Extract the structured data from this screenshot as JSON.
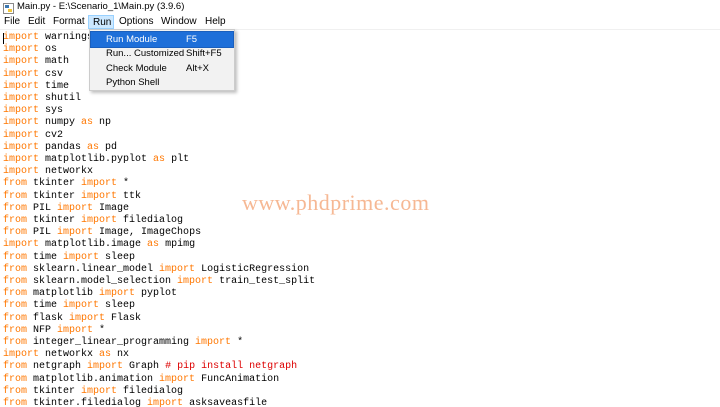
{
  "window": {
    "title": "Main.py - E:\\Scenario_1\\Main.py (3.9.6)"
  },
  "menubar": {
    "items": [
      "File",
      "Edit",
      "Format",
      "Run",
      "Options",
      "Window",
      "Help"
    ],
    "active": "Run"
  },
  "run_menu": {
    "items": [
      {
        "label": "Run Module",
        "accel": "F5",
        "highlighted": true
      },
      {
        "label": "Run... Customized",
        "accel": "Shift+F5"
      },
      {
        "label": "Check Module",
        "accel": "Alt+X"
      },
      {
        "label": "Python Shell",
        "accel": ""
      }
    ]
  },
  "editor": {
    "lines": [
      [
        [
          "kw",
          "import"
        ],
        [
          "t",
          " warnings"
        ]
      ],
      [
        [
          "kw",
          "import"
        ],
        [
          "t",
          " os"
        ]
      ],
      [
        [
          "kw",
          "import"
        ],
        [
          "t",
          " math"
        ]
      ],
      [
        [
          "kw",
          "import"
        ],
        [
          "t",
          " csv"
        ]
      ],
      [
        [
          "kw",
          "import"
        ],
        [
          "t",
          " time"
        ]
      ],
      [
        [
          "kw",
          "import"
        ],
        [
          "t",
          " shutil"
        ]
      ],
      [
        [
          "kw",
          "import"
        ],
        [
          "t",
          " sys"
        ]
      ],
      [
        [
          "kw",
          "import"
        ],
        [
          "t",
          " numpy "
        ],
        [
          "kw",
          "as"
        ],
        [
          "t",
          " np"
        ]
      ],
      [
        [
          "kw",
          "import"
        ],
        [
          "t",
          " cv2"
        ]
      ],
      [
        [
          "kw",
          "import"
        ],
        [
          "t",
          " pandas "
        ],
        [
          "kw",
          "as"
        ],
        [
          "t",
          " pd"
        ]
      ],
      [
        [
          "kw",
          "import"
        ],
        [
          "t",
          " matplotlib.pyplot "
        ],
        [
          "kw",
          "as"
        ],
        [
          "t",
          " plt"
        ]
      ],
      [
        [
          "kw",
          "import"
        ],
        [
          "t",
          " networkx"
        ]
      ],
      [
        [
          "kw",
          "from"
        ],
        [
          "t",
          " tkinter "
        ],
        [
          "kw",
          "import"
        ],
        [
          "t",
          " *"
        ]
      ],
      [
        [
          "kw",
          "from"
        ],
        [
          "t",
          " tkinter "
        ],
        [
          "kw",
          "import"
        ],
        [
          "t",
          " ttk"
        ]
      ],
      [
        [
          "kw",
          "from"
        ],
        [
          "t",
          " PIL "
        ],
        [
          "kw",
          "import"
        ],
        [
          "t",
          " Image"
        ]
      ],
      [
        [
          "kw",
          "from"
        ],
        [
          "t",
          " tkinter "
        ],
        [
          "kw",
          "import"
        ],
        [
          "t",
          " filedialog"
        ]
      ],
      [
        [
          "kw",
          "from"
        ],
        [
          "t",
          " PIL "
        ],
        [
          "kw",
          "import"
        ],
        [
          "t",
          " Image, ImageChops"
        ]
      ],
      [
        [
          "kw",
          "import"
        ],
        [
          "t",
          " matplotlib.image "
        ],
        [
          "kw",
          "as"
        ],
        [
          "t",
          " mpimg"
        ]
      ],
      [
        [
          "kw",
          "from"
        ],
        [
          "t",
          " time "
        ],
        [
          "kw",
          "import"
        ],
        [
          "t",
          " sleep"
        ]
      ],
      [
        [
          "kw",
          "from"
        ],
        [
          "t",
          " sklearn.linear_model "
        ],
        [
          "kw",
          "import"
        ],
        [
          "t",
          " LogisticRegression"
        ]
      ],
      [
        [
          "kw",
          "from"
        ],
        [
          "t",
          " sklearn.model_selection "
        ],
        [
          "kw",
          "import"
        ],
        [
          "t",
          " train_test_split"
        ]
      ],
      [
        [
          "kw",
          "from"
        ],
        [
          "t",
          " matplotlib "
        ],
        [
          "kw",
          "import"
        ],
        [
          "t",
          " pyplot"
        ]
      ],
      [
        [
          "kw",
          "from"
        ],
        [
          "t",
          " time "
        ],
        [
          "kw",
          "import"
        ],
        [
          "t",
          " sleep"
        ]
      ],
      [
        [
          "kw",
          "from"
        ],
        [
          "t",
          " flask "
        ],
        [
          "kw",
          "import"
        ],
        [
          "t",
          " Flask"
        ]
      ],
      [
        [
          "kw",
          "from"
        ],
        [
          "t",
          " NFP "
        ],
        [
          "kw",
          "import"
        ],
        [
          "t",
          " *"
        ]
      ],
      [
        [
          "kw",
          "from"
        ],
        [
          "t",
          " integer_linear_programming "
        ],
        [
          "kw",
          "import"
        ],
        [
          "t",
          " *"
        ]
      ],
      [
        [
          "kw",
          "import"
        ],
        [
          "t",
          " networkx "
        ],
        [
          "kw",
          "as"
        ],
        [
          "t",
          " nx"
        ]
      ],
      [
        [
          "kw",
          "from"
        ],
        [
          "t",
          " netgraph "
        ],
        [
          "kw",
          "import"
        ],
        [
          "t",
          " Graph "
        ],
        [
          "cm",
          "# pip install netgraph"
        ]
      ],
      [
        [
          "kw",
          "from"
        ],
        [
          "t",
          " matplotlib.animation "
        ],
        [
          "kw",
          "import"
        ],
        [
          "t",
          " FuncAnimation"
        ]
      ],
      [
        [
          "kw",
          "from"
        ],
        [
          "t",
          " tkinter "
        ],
        [
          "kw",
          "import"
        ],
        [
          "t",
          " filedialog"
        ]
      ],
      [
        [
          "kw",
          "from"
        ],
        [
          "t",
          " tkinter.filedialog "
        ],
        [
          "kw",
          "import"
        ],
        [
          "t",
          " asksaveasfile"
        ]
      ]
    ]
  },
  "watermark": "www.phdprime.com",
  "colors": {
    "keyword": "#ff7700",
    "comment": "#dd0000",
    "menu_highlight": "#1e6fd9",
    "watermark": "#f6b894"
  },
  "icons": {
    "app": "idle-python-icon"
  }
}
